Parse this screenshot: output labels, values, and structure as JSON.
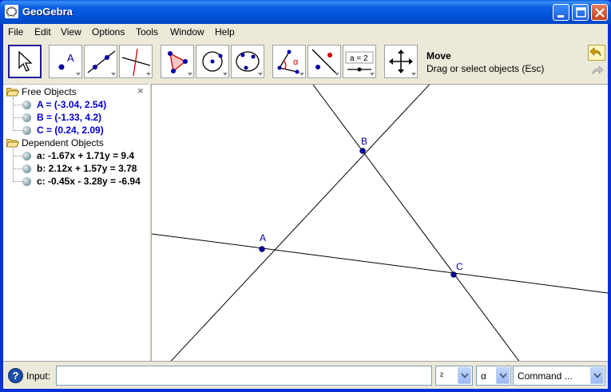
{
  "window": {
    "title": "GeoGebra"
  },
  "menu": {
    "items": [
      "File",
      "Edit",
      "View",
      "Options",
      "Tools",
      "Window",
      "Help"
    ]
  },
  "toolbar": {
    "active_tool_name": "Move",
    "active_tool_help": "Drag or select objects (Esc)",
    "tools": [
      "move-tool",
      "point-tool",
      "line-through-two-points-tool",
      "perpendicular-line-tool",
      "polygon-tool",
      "circle-center-point-tool",
      "circle-three-points-tool",
      "angle-tool",
      "reflect-about-line-tool",
      "slider-tool",
      "move-graphics-view-tool"
    ],
    "slider_label": "a = 2",
    "point_label": "A",
    "angle_label": "α"
  },
  "algebra_view": {
    "close_symbol": "×",
    "free_folder": "Free Objects",
    "free_items": [
      "A = (-3.04, 2.54)",
      "B = (-1.33, 4.2)",
      "C = (0.24, 2.09)"
    ],
    "dependent_folder": "Dependent Objects",
    "dependent_items": [
      "a: -1.67x + 1.71y = 9.4",
      "b: 2.12x + 1.57y = 3.78",
      "c: -0.45x - 3.28y = -6.94"
    ]
  },
  "graphics": {
    "point_labels": {
      "A": "A",
      "B": "B",
      "C": "C"
    }
  },
  "input_bar": {
    "label": "Input:",
    "value": "",
    "help_symbol": "?",
    "superscript_combo": "²",
    "greek_combo": "α",
    "command_combo": "Command ..."
  },
  "colors": {
    "titlebar": "#0a5fe3",
    "point": "#0000a0",
    "free_objects": "#0000c8"
  }
}
